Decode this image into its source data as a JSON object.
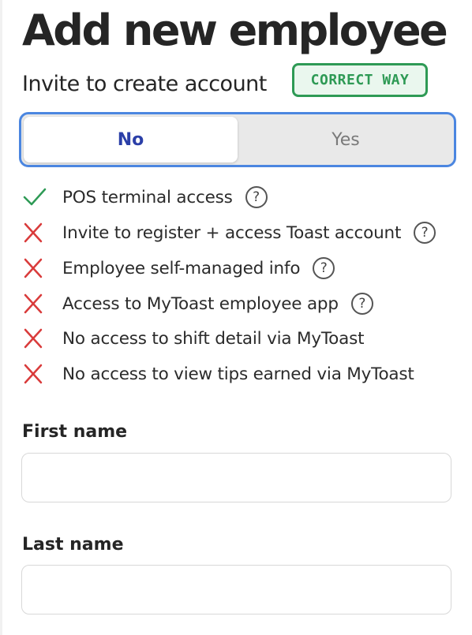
{
  "page": {
    "title": "Add new employee"
  },
  "invite": {
    "label": "Invite to create account",
    "badge": "CORRECT WAY",
    "options": [
      "No",
      "Yes"
    ],
    "selected": "No"
  },
  "features": [
    {
      "label": "POS terminal access",
      "status": "check-icon",
      "help": true
    },
    {
      "label": "Invite to register + access Toast account",
      "status": "x-icon",
      "help": true
    },
    {
      "label": "Employee self-managed info",
      "status": "x-icon",
      "help": true
    },
    {
      "label": "Access to MyToast employee app",
      "status": "x-icon",
      "help": true
    },
    {
      "label": "No access to shift detail via MyToast",
      "status": "x-icon",
      "help": false
    },
    {
      "label": "No access to view tips earned via MyToast",
      "status": "x-icon",
      "help": false
    }
  ],
  "help_glyph": "?",
  "form": {
    "first_name": {
      "label": "First name",
      "value": "",
      "placeholder": ""
    },
    "last_name": {
      "label": "Last name",
      "value": "",
      "placeholder": ""
    }
  },
  "colors": {
    "check": "#2e9a55",
    "cross": "#d93b3b",
    "toggle_border": "#4b86e0",
    "selected_text": "#2b3fa8"
  }
}
